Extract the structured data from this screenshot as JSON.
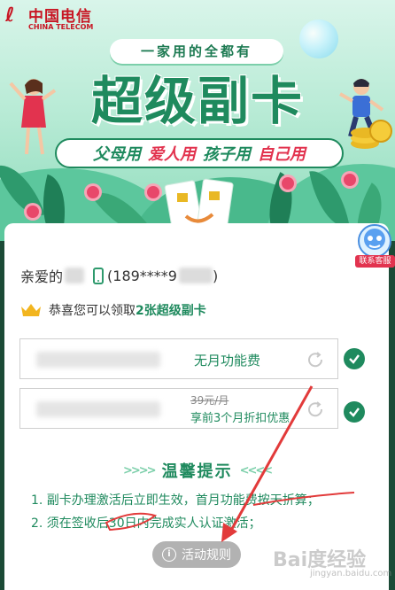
{
  "banner": {
    "logo_cn": "中国电信",
    "logo_en": "CHINA TELECOM",
    "tagline": "一家用的全都有",
    "title": "超级副卡",
    "categories": [
      {
        "label": "父母用",
        "color": "green"
      },
      {
        "label": "爱人用",
        "color": "red"
      },
      {
        "label": "孩子用",
        "color": "green"
      },
      {
        "label": "自己用",
        "color": "red"
      }
    ]
  },
  "support": {
    "label": "联系客服"
  },
  "greeting": {
    "prefix": "亲爱的",
    "open_paren": "(",
    "phone": "189****9",
    "close_paren": ")"
  },
  "congrats": {
    "prefix": "恭喜您可以领取",
    "highlight": "2张超级副卡"
  },
  "offers": [
    {
      "text": "无月功能费",
      "selected": true
    },
    {
      "old_price": "39元/月",
      "text": "享前3个月折扣优惠",
      "selected": true
    }
  ],
  "tips": {
    "title": "温馨提示",
    "items": [
      "1. 副卡办理激活后立即生效，首月功能费按天折算；",
      "2. 须在签收后30日内完成实人认证激活；"
    ]
  },
  "rules_button": {
    "label": "活动规则"
  },
  "watermark": {
    "text": "Bai度经验",
    "url": "jingyan.baidu.com"
  },
  "colors": {
    "brand_green": "#1f8a5e",
    "accent_red": "#e2334f",
    "annotation_red": "#e23a3a",
    "button_gray": "#b2b2b2"
  }
}
